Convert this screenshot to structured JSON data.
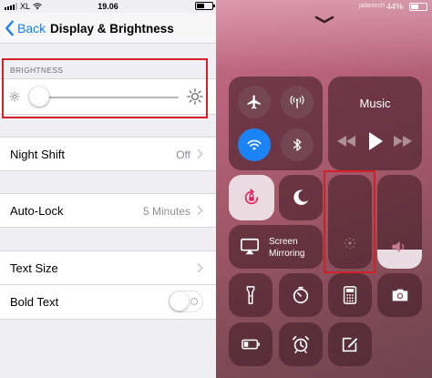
{
  "settings": {
    "status": {
      "carrier": "XL",
      "time": "19.06"
    },
    "nav": {
      "back_label": "Back",
      "title": "Display & Brightness"
    },
    "brightness": {
      "section_header": "BRIGHTNESS",
      "level": 0.04
    },
    "night_shift": {
      "label": "Night Shift",
      "value": "Off"
    },
    "auto_lock": {
      "label": "Auto-Lock",
      "value": "5 Minutes"
    },
    "text_size": {
      "label": "Text Size"
    },
    "bold_text": {
      "label": "Bold Text",
      "enabled": false
    }
  },
  "control_center": {
    "status": {
      "battery": "44%",
      "watermark": "jalantech"
    },
    "connectivity": {
      "airplane": {
        "icon": "airplane-icon",
        "active": false
      },
      "cellular": {
        "icon": "cellular-antenna-icon",
        "active": false
      },
      "wifi": {
        "icon": "wifi-icon",
        "active": true
      },
      "bluetooth": {
        "icon": "bluetooth-icon",
        "active": false
      }
    },
    "music": {
      "title": "Music"
    },
    "screen_mirroring": {
      "line1": "Screen",
      "line2": "Mirroring"
    },
    "brightness_level": 0.0,
    "volume_level": 0.2,
    "tiles": [
      "rotation-lock-icon",
      "do-not-disturb-moon-icon",
      "flashlight-icon",
      "timer-icon",
      "calculator-icon",
      "camera-icon",
      "low-power-battery-icon",
      "alarm-clock-icon",
      "notes-compose-icon"
    ]
  },
  "colors": {
    "ios_blue": "#147efb",
    "wifi_active": "#1a84f6",
    "highlight_red": "#d42027"
  }
}
